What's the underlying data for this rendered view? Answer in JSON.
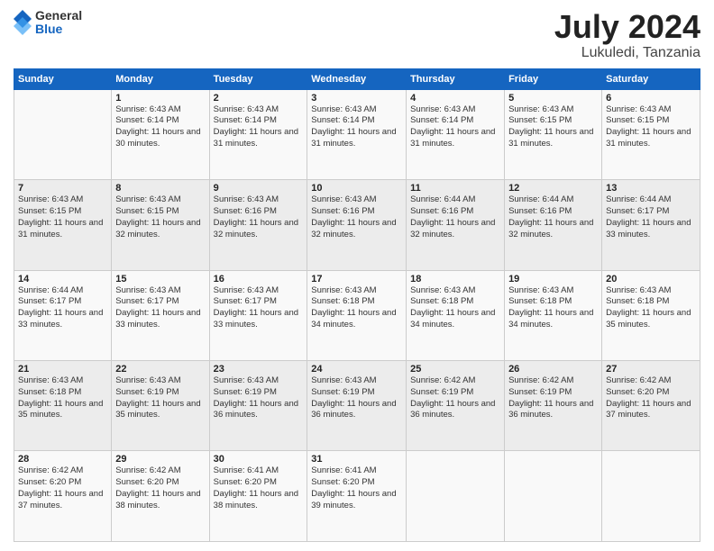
{
  "logo": {
    "general": "General",
    "blue": "Blue"
  },
  "header": {
    "month": "July 2024",
    "location": "Lukuledi, Tanzania"
  },
  "days_of_week": [
    "Sunday",
    "Monday",
    "Tuesday",
    "Wednesday",
    "Thursday",
    "Friday",
    "Saturday"
  ],
  "weeks": [
    [
      {
        "day": "",
        "sunrise": "",
        "sunset": "",
        "daylight": ""
      },
      {
        "day": "1",
        "sunrise": "Sunrise: 6:43 AM",
        "sunset": "Sunset: 6:14 PM",
        "daylight": "Daylight: 11 hours and 30 minutes."
      },
      {
        "day": "2",
        "sunrise": "Sunrise: 6:43 AM",
        "sunset": "Sunset: 6:14 PM",
        "daylight": "Daylight: 11 hours and 31 minutes."
      },
      {
        "day": "3",
        "sunrise": "Sunrise: 6:43 AM",
        "sunset": "Sunset: 6:14 PM",
        "daylight": "Daylight: 11 hours and 31 minutes."
      },
      {
        "day": "4",
        "sunrise": "Sunrise: 6:43 AM",
        "sunset": "Sunset: 6:14 PM",
        "daylight": "Daylight: 11 hours and 31 minutes."
      },
      {
        "day": "5",
        "sunrise": "Sunrise: 6:43 AM",
        "sunset": "Sunset: 6:15 PM",
        "daylight": "Daylight: 11 hours and 31 minutes."
      },
      {
        "day": "6",
        "sunrise": "Sunrise: 6:43 AM",
        "sunset": "Sunset: 6:15 PM",
        "daylight": "Daylight: 11 hours and 31 minutes."
      }
    ],
    [
      {
        "day": "7",
        "sunrise": "Sunrise: 6:43 AM",
        "sunset": "Sunset: 6:15 PM",
        "daylight": "Daylight: 11 hours and 31 minutes."
      },
      {
        "day": "8",
        "sunrise": "Sunrise: 6:43 AM",
        "sunset": "Sunset: 6:15 PM",
        "daylight": "Daylight: 11 hours and 32 minutes."
      },
      {
        "day": "9",
        "sunrise": "Sunrise: 6:43 AM",
        "sunset": "Sunset: 6:16 PM",
        "daylight": "Daylight: 11 hours and 32 minutes."
      },
      {
        "day": "10",
        "sunrise": "Sunrise: 6:43 AM",
        "sunset": "Sunset: 6:16 PM",
        "daylight": "Daylight: 11 hours and 32 minutes."
      },
      {
        "day": "11",
        "sunrise": "Sunrise: 6:44 AM",
        "sunset": "Sunset: 6:16 PM",
        "daylight": "Daylight: 11 hours and 32 minutes."
      },
      {
        "day": "12",
        "sunrise": "Sunrise: 6:44 AM",
        "sunset": "Sunset: 6:16 PM",
        "daylight": "Daylight: 11 hours and 32 minutes."
      },
      {
        "day": "13",
        "sunrise": "Sunrise: 6:44 AM",
        "sunset": "Sunset: 6:17 PM",
        "daylight": "Daylight: 11 hours and 33 minutes."
      }
    ],
    [
      {
        "day": "14",
        "sunrise": "Sunrise: 6:44 AM",
        "sunset": "Sunset: 6:17 PM",
        "daylight": "Daylight: 11 hours and 33 minutes."
      },
      {
        "day": "15",
        "sunrise": "Sunrise: 6:43 AM",
        "sunset": "Sunset: 6:17 PM",
        "daylight": "Daylight: 11 hours and 33 minutes."
      },
      {
        "day": "16",
        "sunrise": "Sunrise: 6:43 AM",
        "sunset": "Sunset: 6:17 PM",
        "daylight": "Daylight: 11 hours and 33 minutes."
      },
      {
        "day": "17",
        "sunrise": "Sunrise: 6:43 AM",
        "sunset": "Sunset: 6:18 PM",
        "daylight": "Daylight: 11 hours and 34 minutes."
      },
      {
        "day": "18",
        "sunrise": "Sunrise: 6:43 AM",
        "sunset": "Sunset: 6:18 PM",
        "daylight": "Daylight: 11 hours and 34 minutes."
      },
      {
        "day": "19",
        "sunrise": "Sunrise: 6:43 AM",
        "sunset": "Sunset: 6:18 PM",
        "daylight": "Daylight: 11 hours and 34 minutes."
      },
      {
        "day": "20",
        "sunrise": "Sunrise: 6:43 AM",
        "sunset": "Sunset: 6:18 PM",
        "daylight": "Daylight: 11 hours and 35 minutes."
      }
    ],
    [
      {
        "day": "21",
        "sunrise": "Sunrise: 6:43 AM",
        "sunset": "Sunset: 6:18 PM",
        "daylight": "Daylight: 11 hours and 35 minutes."
      },
      {
        "day": "22",
        "sunrise": "Sunrise: 6:43 AM",
        "sunset": "Sunset: 6:19 PM",
        "daylight": "Daylight: 11 hours and 35 minutes."
      },
      {
        "day": "23",
        "sunrise": "Sunrise: 6:43 AM",
        "sunset": "Sunset: 6:19 PM",
        "daylight": "Daylight: 11 hours and 36 minutes."
      },
      {
        "day": "24",
        "sunrise": "Sunrise: 6:43 AM",
        "sunset": "Sunset: 6:19 PM",
        "daylight": "Daylight: 11 hours and 36 minutes."
      },
      {
        "day": "25",
        "sunrise": "Sunrise: 6:42 AM",
        "sunset": "Sunset: 6:19 PM",
        "daylight": "Daylight: 11 hours and 36 minutes."
      },
      {
        "day": "26",
        "sunrise": "Sunrise: 6:42 AM",
        "sunset": "Sunset: 6:19 PM",
        "daylight": "Daylight: 11 hours and 36 minutes."
      },
      {
        "day": "27",
        "sunrise": "Sunrise: 6:42 AM",
        "sunset": "Sunset: 6:20 PM",
        "daylight": "Daylight: 11 hours and 37 minutes."
      }
    ],
    [
      {
        "day": "28",
        "sunrise": "Sunrise: 6:42 AM",
        "sunset": "Sunset: 6:20 PM",
        "daylight": "Daylight: 11 hours and 37 minutes."
      },
      {
        "day": "29",
        "sunrise": "Sunrise: 6:42 AM",
        "sunset": "Sunset: 6:20 PM",
        "daylight": "Daylight: 11 hours and 38 minutes."
      },
      {
        "day": "30",
        "sunrise": "Sunrise: 6:41 AM",
        "sunset": "Sunset: 6:20 PM",
        "daylight": "Daylight: 11 hours and 38 minutes."
      },
      {
        "day": "31",
        "sunrise": "Sunrise: 6:41 AM",
        "sunset": "Sunset: 6:20 PM",
        "daylight": "Daylight: 11 hours and 39 minutes."
      },
      {
        "day": "",
        "sunrise": "",
        "sunset": "",
        "daylight": ""
      },
      {
        "day": "",
        "sunrise": "",
        "sunset": "",
        "daylight": ""
      },
      {
        "day": "",
        "sunrise": "",
        "sunset": "",
        "daylight": ""
      }
    ]
  ]
}
